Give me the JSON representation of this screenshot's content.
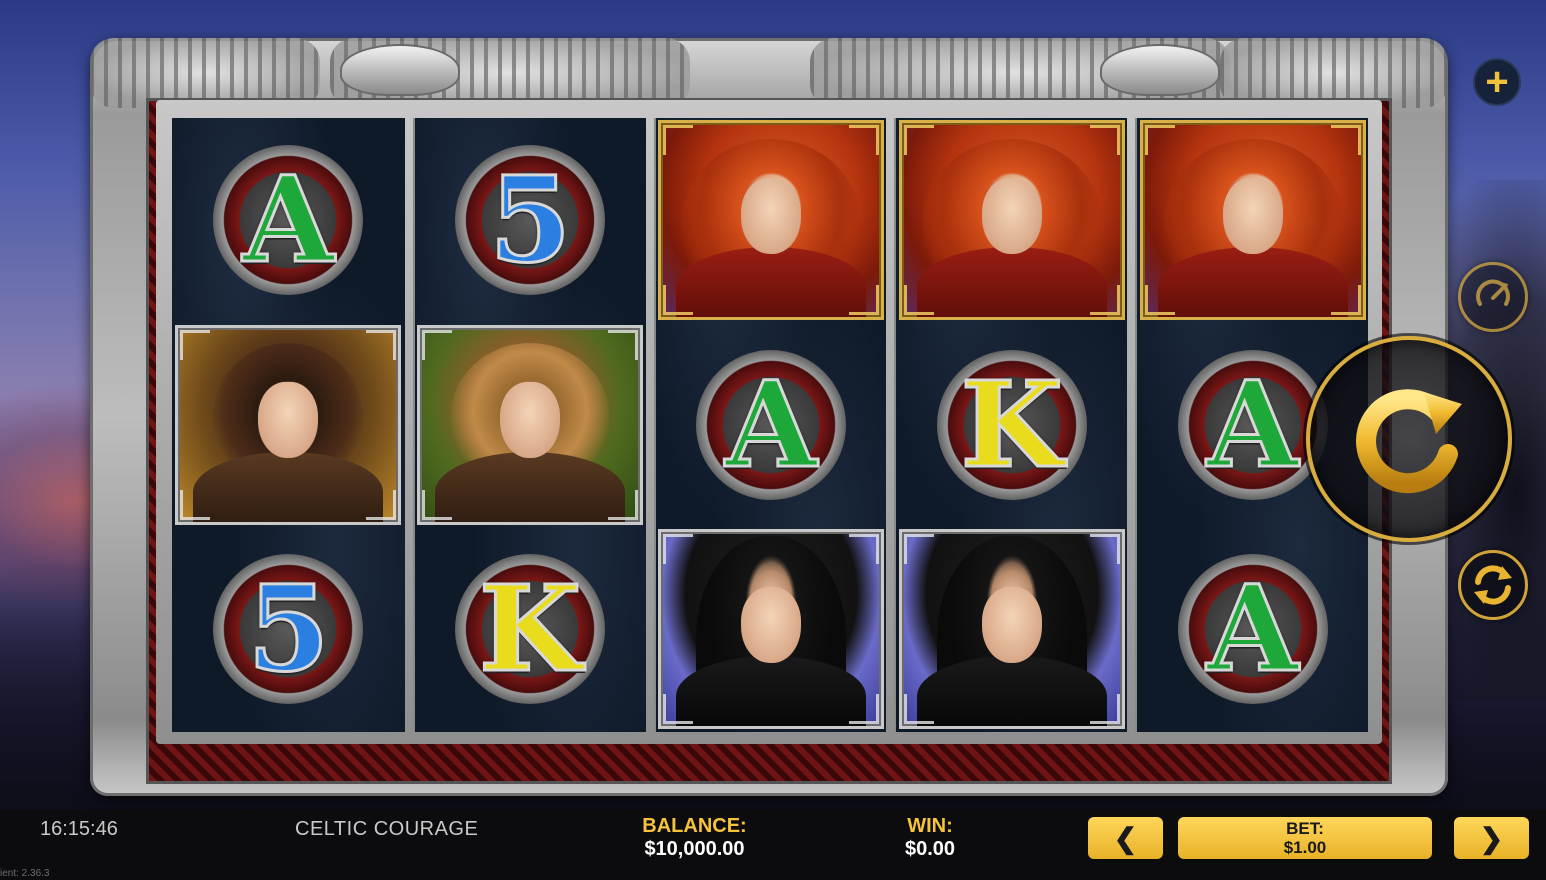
{
  "game": {
    "title": "CELTIC COURAGE",
    "clock": "16:15:46",
    "version": "ient: 2.36.3"
  },
  "reels": [
    [
      "A",
      "bearded-warrior",
      "5"
    ],
    [
      "5",
      "blond-warrior",
      "K"
    ],
    [
      "red-haired-heroine",
      "A",
      "hooded-man"
    ],
    [
      "red-haired-heroine",
      "K",
      "hooded-man"
    ],
    [
      "red-haired-heroine",
      "A",
      "A"
    ]
  ],
  "symbols": {
    "A": {
      "glyph": "A",
      "color": "#1ea83a"
    },
    "5": {
      "glyph": "5",
      "color": "#2b7fe0"
    },
    "K": {
      "glyph": "K",
      "color": "#e9dc1c"
    }
  },
  "stats": {
    "balance_label": "BALANCE:",
    "balance_value": "$10,000.00",
    "win_label": "WIN:",
    "win_value": "$0.00",
    "bet_label": "BET:",
    "bet_value": "$1.00"
  },
  "controls": {
    "bet_decrease": "❮",
    "bet_increase": "❯",
    "menu": "+",
    "accent_color": "#f6c33a"
  },
  "icons": [
    "plus-icon",
    "turbo-icon",
    "spin-icon",
    "autoplay-icon",
    "chevron-left-icon",
    "chevron-right-icon"
  ]
}
